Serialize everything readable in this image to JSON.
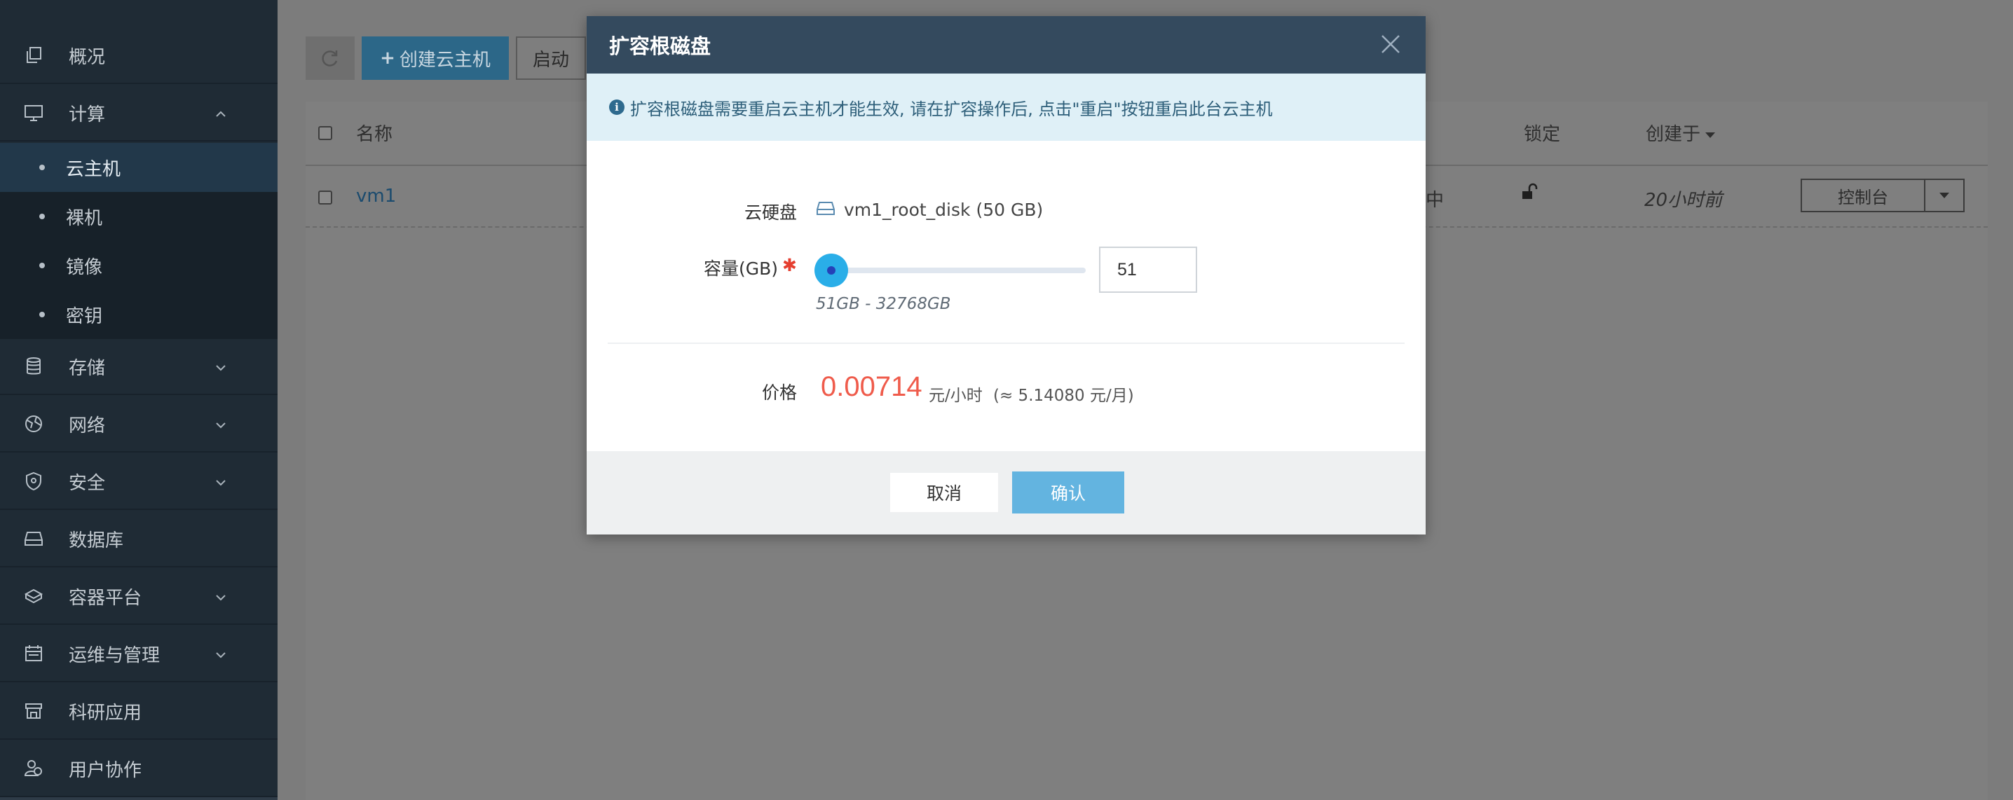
{
  "sidebar": {
    "overview": "概况",
    "compute": "计算",
    "compute_sub": [
      "云主机",
      "裸机",
      "镜像",
      "密钥"
    ],
    "storage": "存储",
    "network": "网络",
    "security": "安全",
    "database": "数据库",
    "container": "容器平台",
    "ops": "运维与管理",
    "research": "科研应用",
    "collab": "用户协作"
  },
  "toolbar": {
    "create_label": "创建云主机",
    "start_label": "启动"
  },
  "table": {
    "col_name": "名称",
    "col_lock": "锁定",
    "col_created": "创建于",
    "row": {
      "name": "vm1",
      "status_partial": "中",
      "created": "20小时前",
      "console_label": "控制台"
    }
  },
  "modal": {
    "title": "扩容根磁盘",
    "notice": "扩容根磁盘需要重启云主机才能生效, 请在扩容操作后, 点击\"重启\"按钮重启此台云主机",
    "disk_label": "云硬盘",
    "disk_value": "vm1_root_disk (50 GB)",
    "capacity_label": "容量(GB)",
    "required_mark": "✱",
    "capacity_value": "51",
    "range_hint": "51GB - 32768GB",
    "price_label": "价格",
    "price_value": "0.00714",
    "price_unit": "元/小时",
    "price_month": "(≈ 5.14080 元/月)",
    "cancel_label": "取消",
    "confirm_label": "确认"
  },
  "colors": {
    "header": "#344a5e",
    "notice_bg": "#dff0f7",
    "price": "#ef5b4b",
    "slider_handle": "#2aaee8",
    "confirm": "#63b4e0"
  }
}
